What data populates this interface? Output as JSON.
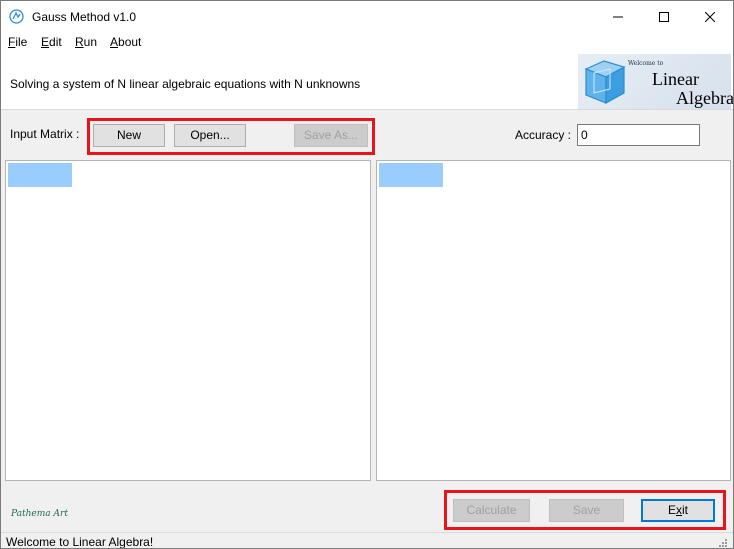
{
  "window": {
    "title": "Gauss Method v1.0",
    "icon": "gauss-app-icon"
  },
  "menu": {
    "items": [
      {
        "label": "File",
        "mnemonic": "F",
        "rest": "ile"
      },
      {
        "label": "Edit",
        "mnemonic": "E",
        "rest": "dit"
      },
      {
        "label": "Run",
        "mnemonic": "R",
        "rest": "un"
      },
      {
        "label": "About",
        "mnemonic": "A",
        "rest": "bout"
      }
    ]
  },
  "header": {
    "subtitle": "Solving a system of N linear algebraic equations with N unknowns",
    "logo": {
      "welcome": "Welcome to",
      "line1": "Linear",
      "line2": "Algebra"
    }
  },
  "toolbar": {
    "input_label": "Input Matrix :",
    "new_label": "New",
    "open_label": "Open...",
    "save_as_label": "Save As...",
    "save_as_enabled": false,
    "accuracy_label": "Accuracy :",
    "accuracy_value": "0"
  },
  "bottom": {
    "calculate_label": "Calculate",
    "calculate_enabled": false,
    "save_label": "Save",
    "save_enabled": false,
    "exit_label": "Exit",
    "exit_mnemonic": "x",
    "signature": "Pathema Art"
  },
  "status": {
    "text": "Welcome to Linear Algebra!"
  },
  "colors": {
    "highlight": "#e8141c",
    "selected_cell": "#99ccff",
    "focus": "#0078d7"
  }
}
